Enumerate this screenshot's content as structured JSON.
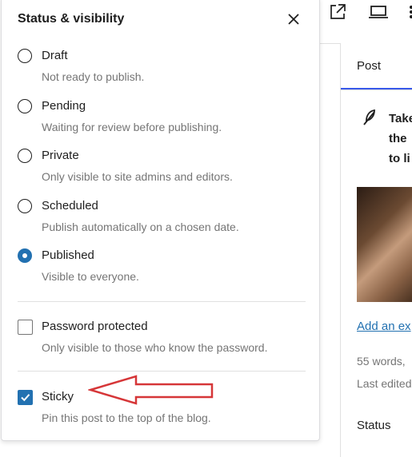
{
  "popover": {
    "title": "Status & visibility",
    "close_icon": "close-icon",
    "options": [
      {
        "label": "Draft",
        "help": "Not ready to publish.",
        "checked": false
      },
      {
        "label": "Pending",
        "help": "Waiting for review before publishing.",
        "checked": false
      },
      {
        "label": "Private",
        "help": "Only visible to site admins and editors.",
        "checked": false
      },
      {
        "label": "Scheduled",
        "help": "Publish automatically on a chosen date.",
        "checked": false
      },
      {
        "label": "Published",
        "help": "Visible to everyone.",
        "checked": true
      }
    ],
    "password": {
      "label": "Password protected",
      "help": "Only visible to those who know the password.",
      "checked": false
    },
    "sticky": {
      "label": "Sticky",
      "help": "Pin this post to the top of the blog.",
      "checked": true
    }
  },
  "topbar": {
    "icons": [
      "external-link-icon",
      "desktop-preview-icon"
    ]
  },
  "sidebar": {
    "tab": "Post",
    "post_title_lines": [
      "Take",
      "the",
      "to li"
    ],
    "post_icon": "feather-icon",
    "excerpt_link": "Add an ex",
    "word_count": "55 words,",
    "last_edited": "Last edited",
    "status_label": "Status"
  },
  "annotation": {
    "type": "red-arrow",
    "points_to": "Sticky",
    "color": "#d63638"
  },
  "colors": {
    "accent": "#2271b1",
    "tab_indicator": "#3858e9",
    "help_text": "#757575",
    "annotation": "#d63638"
  }
}
